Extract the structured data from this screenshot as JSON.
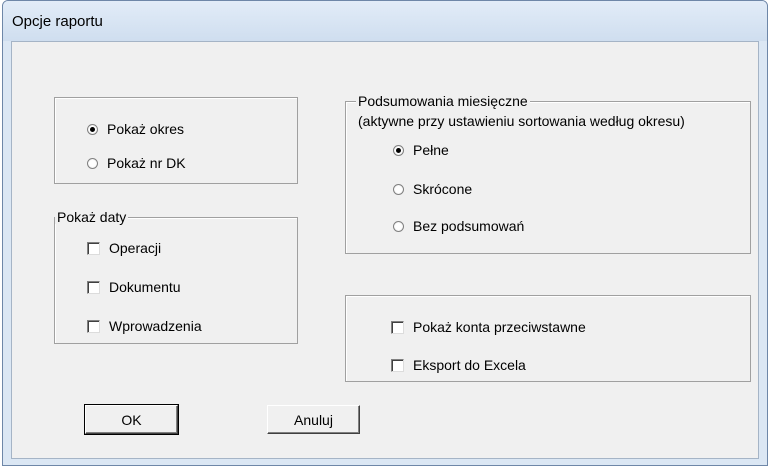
{
  "window": {
    "title": "Opcje raportu"
  },
  "period_group": {
    "options": [
      {
        "label": "Pokaż okres",
        "selected": true
      },
      {
        "label": "Pokaż nr DK",
        "selected": false
      }
    ]
  },
  "dates_group": {
    "legend": "Pokaż daty",
    "options": [
      {
        "label": "Operacji",
        "checked": false
      },
      {
        "label": "Dokumentu",
        "checked": false
      },
      {
        "label": "Wprowadzenia",
        "checked": false
      }
    ]
  },
  "monthly_group": {
    "legend": "Podsumowania miesięczne",
    "subtitle": "(aktywne przy ustawieniu sortowania według okresu)",
    "options": [
      {
        "label": "Pełne",
        "selected": true
      },
      {
        "label": "Skrócone",
        "selected": false
      },
      {
        "label": "Bez podsumowań",
        "selected": false
      }
    ]
  },
  "extra_group": {
    "options": [
      {
        "label": "Pokaż konta przeciwstawne",
        "checked": false
      },
      {
        "label": "Eksport do Excela",
        "checked": false
      }
    ]
  },
  "buttons": {
    "ok": "OK",
    "cancel": "Anuluj"
  }
}
